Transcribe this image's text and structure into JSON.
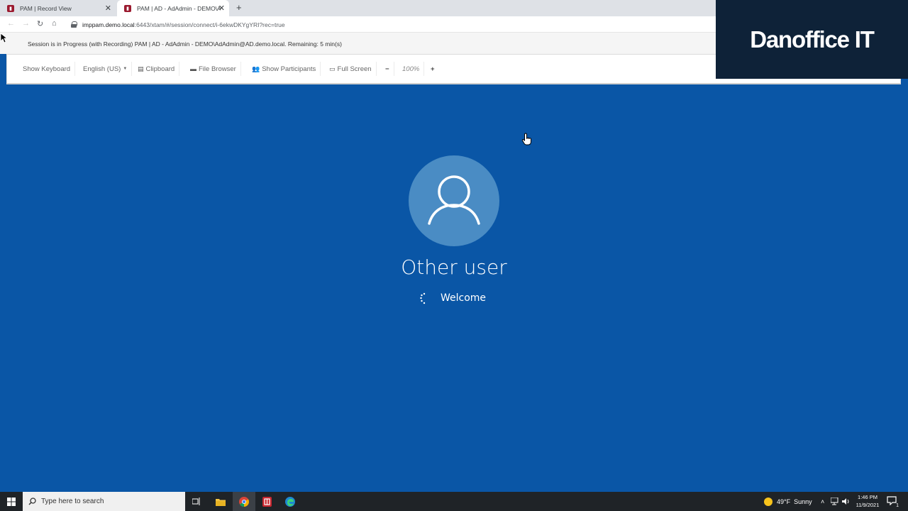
{
  "browser": {
    "tabs": [
      {
        "title": "PAM | Record View",
        "active": false
      },
      {
        "title": "PAM | AD - AdAdmin - DEMO\\A",
        "active": true
      }
    ],
    "url_host": "imppam.demo.local",
    "url_path": ":6443/xtam/#/session/connect/i-6ekwDKYgYRI?rec=true"
  },
  "session": {
    "status_text": "Session is in Progress (with Recording) PAM | AD - AdAdmin - DEMO\\AdAdmin@AD.demo.local. Remaining: 5 min(s)"
  },
  "toolbar": {
    "show_keyboard": "Show Keyboard",
    "language": "English (US)",
    "clipboard": "Clipboard",
    "file_browser": "File Browser",
    "show_participants": "Show Participants",
    "full_screen": "Full Screen",
    "zoom_minus": "−",
    "zoom_level": "100%",
    "zoom_plus": "+"
  },
  "brand": {
    "name": "Danoffice IT"
  },
  "login": {
    "username": "Other user",
    "status": "Welcome"
  },
  "taskbar": {
    "search_placeholder": "Type here to search",
    "weather": "49°F  Sunny",
    "time": "1:46 PM",
    "date": "11/9/2021",
    "notification_count": "1"
  },
  "colors": {
    "desktop_bg": "#0a56a6",
    "avatar_bg": "#4a8cc4",
    "taskbar_bg": "#1f2327",
    "brand_bg": "#0e2238"
  }
}
